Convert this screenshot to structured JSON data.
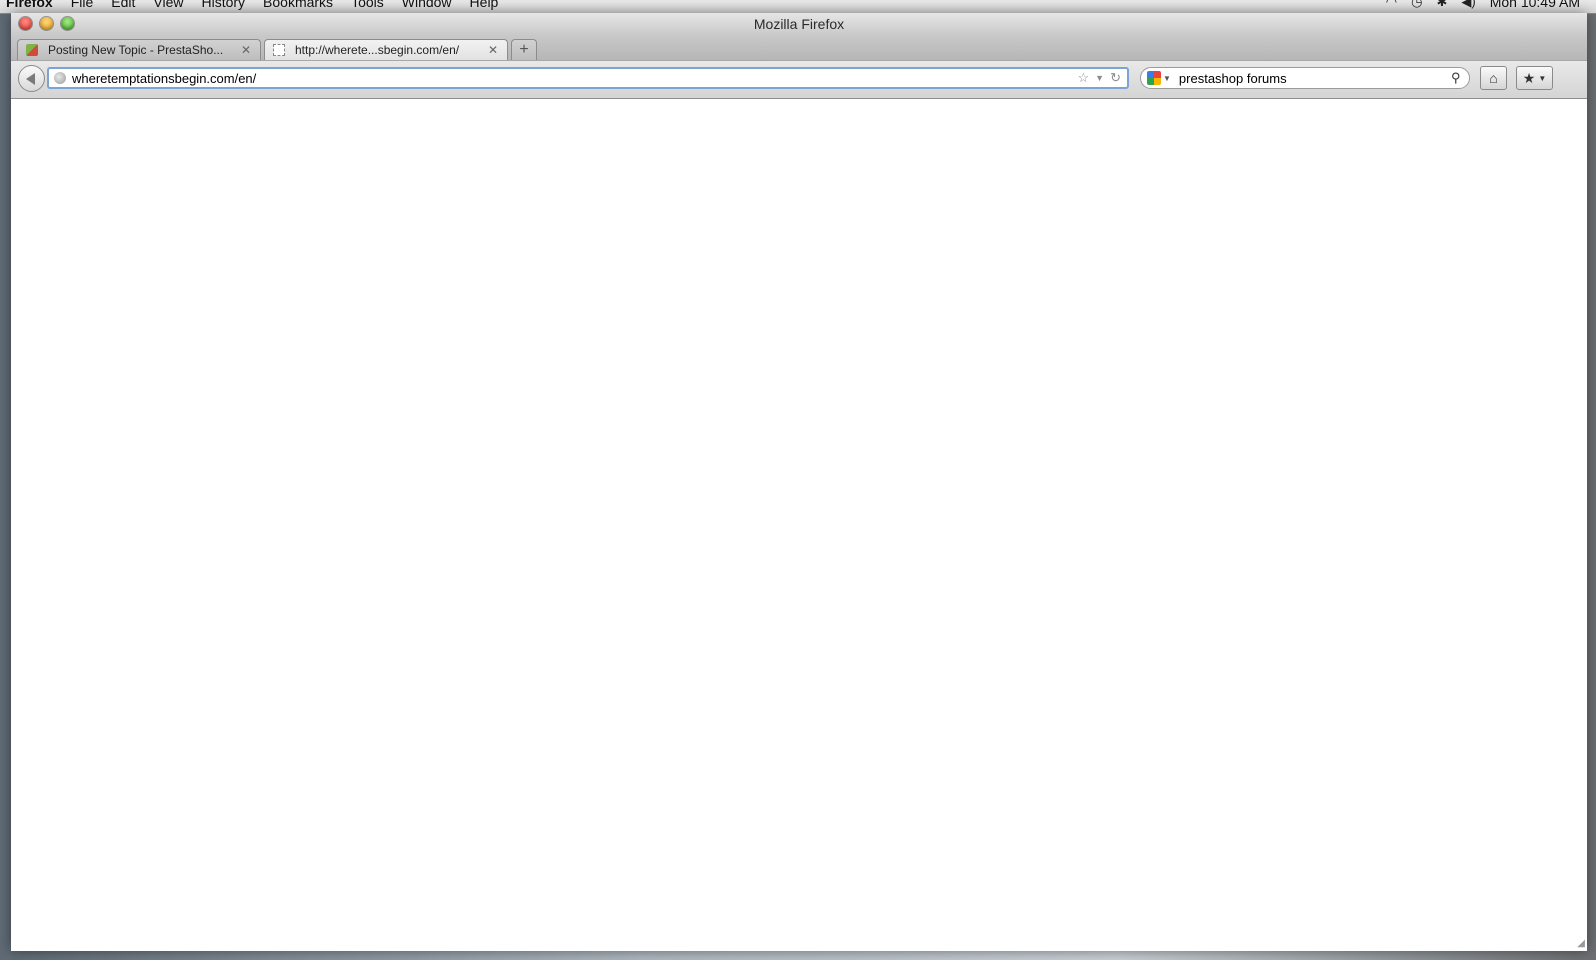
{
  "menubar": {
    "items": [
      "Firefox",
      "File",
      "Edit",
      "View",
      "History",
      "Bookmarks",
      "Tools",
      "Window",
      "Help"
    ],
    "clock": "Mon 10:49 AM",
    "status_icons": [
      "wifi-icon",
      "time-machine-icon",
      "bluetooth-icon",
      "volume-icon"
    ]
  },
  "window": {
    "title": "Mozilla Firefox",
    "tabs": [
      {
        "label": "Posting New Topic - PrestaSho...",
        "active": false,
        "favicon": "prestashop-favicon"
      },
      {
        "label": "http://wherete...sbegin.com/en/",
        "active": true,
        "favicon": "blank-page-favicon"
      }
    ],
    "new_tab_symbol": "+",
    "address_bar": {
      "value": "wheretemptationsbegin.com/en/"
    },
    "search_bar": {
      "value": "prestashop forums",
      "engine": "google-icon"
    }
  },
  "colors": {
    "url_focus_ring": "#7da2d6",
    "close": "#e0342a",
    "minimize": "#e59c19",
    "zoom": "#3ca722"
  }
}
